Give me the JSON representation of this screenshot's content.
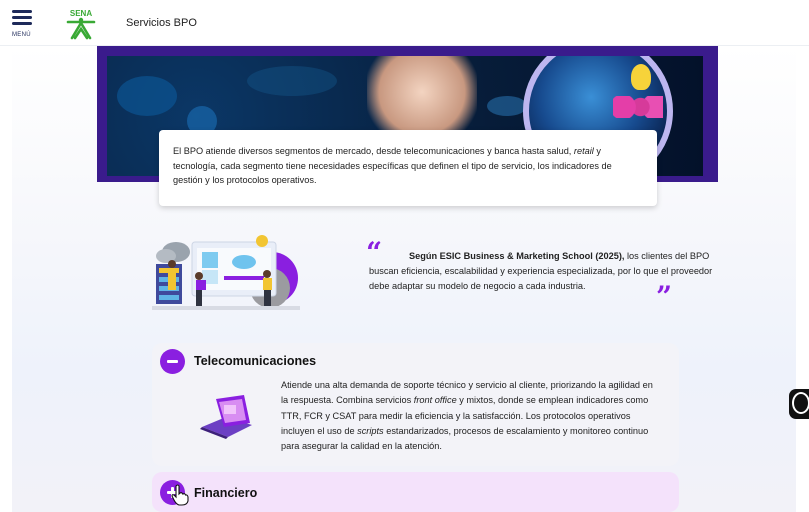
{
  "header": {
    "menu_label": "MENÚ",
    "logo_text": "SENA",
    "title": "Servicios BPO"
  },
  "intro": {
    "text_before": "El BPO atiende diversos segmentos de mercado, desde telecomunicaciones y banca hasta salud, ",
    "text_italic": "retail",
    "text_after": " y tecnología, cada segmento tiene necesidades específicas que definen el tipo de servicio, los indicadores de gestión y los protocolos operativos."
  },
  "quote": {
    "bold": "Según ESIC Business & Marketing School (2025),",
    "rest": " los clientes del BPO buscan eficiencia, escalabilidad y experiencia especializada, por lo que el proveedor debe adaptar su modelo de negocio a cada industria."
  },
  "accordion": [
    {
      "title": "Telecomunicaciones",
      "expanded": true,
      "body_parts": [
        {
          "t": "Atiende una alta demanda de soporte técnico y servicio al cliente, priorizando la agilidad en la respuesta. Combina servicios ",
          "i": false
        },
        {
          "t": "front office",
          "i": true
        },
        {
          "t": " y mixtos, donde se emplean indicadores como TTR, FCR y CSAT para medir la eficiencia y la satisfacción. Los protocolos operativos incluyen el uso de ",
          "i": false
        },
        {
          "t": "scripts",
          "i": true
        },
        {
          "t": " estandarizados, procesos de escalamiento y monitoreo continuo para asegurar la calidad en la atención.",
          "i": false
        }
      ]
    },
    {
      "title": "Financiero",
      "expanded": false
    }
  ],
  "colors": {
    "accent": "#8a1fe0",
    "banner_frame": "#3a1b8c",
    "highlight": "#f8e4fb",
    "closed_item_bg": "#f4e2fb",
    "logo_green": "#39a935"
  },
  "icons": [
    "menu-icon",
    "sena-logo",
    "quote-open-icon",
    "quote-close-icon",
    "minus-icon",
    "plus-icon",
    "accessibility-icon",
    "hand-cursor-icon"
  ]
}
